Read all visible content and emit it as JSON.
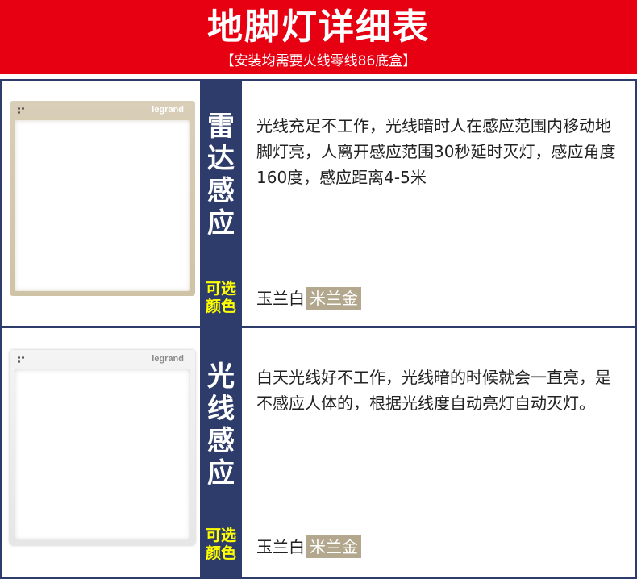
{
  "header": {
    "title": "地脚灯详细表",
    "subtitle": "【安装均需要火线零线86底盒】"
  },
  "colors": {
    "header_red": "#e60012",
    "navy": "#2d3c6b",
    "option_yellow": "#ffff00",
    "gold_chip": "#b3a88e"
  },
  "rows": [
    {
      "type": "雷达感应",
      "type_chars": [
        "雷",
        "达",
        "感",
        "应"
      ],
      "description": "光线充足不工作，光线暗时人在感应范围内移动地脚灯亮，人离开感应范围30秒延时灭灯，感应角度160度，感应距离4-5米",
      "option_label_line1": "可选",
      "option_label_line2": "颜色",
      "color_white": "玉兰白",
      "color_gold": "米兰金",
      "brand": "legrand",
      "plate_color": "gold"
    },
    {
      "type": "光线感应",
      "type_chars": [
        "光",
        "线",
        "感",
        "应"
      ],
      "description": "白天光线好不工作，光线暗的时候就会一直亮，是不感应人体的，根据光线度自动亮灯自动灭灯。",
      "option_label_line1": "可选",
      "option_label_line2": "颜色",
      "color_white": "玉兰白",
      "color_gold": "米兰金",
      "brand": "legrand",
      "plate_color": "white"
    }
  ]
}
